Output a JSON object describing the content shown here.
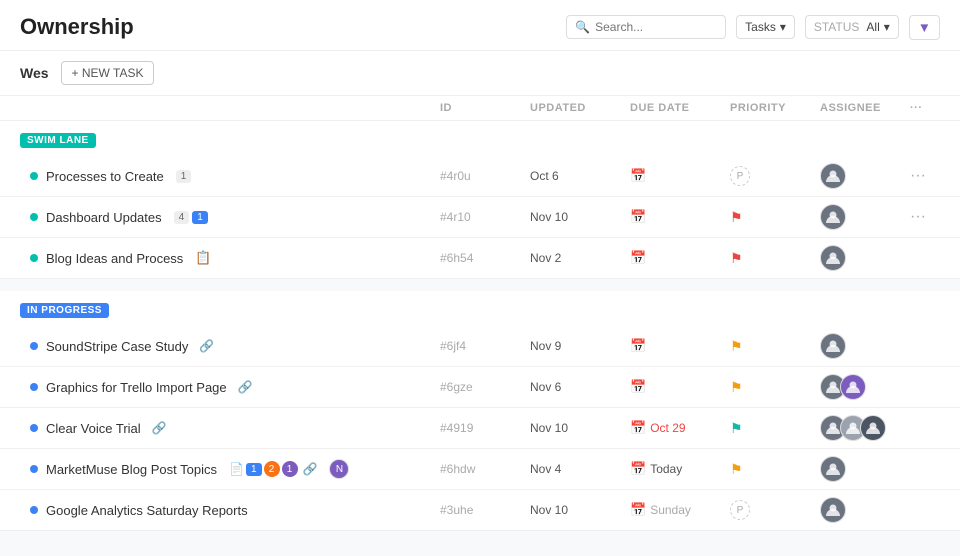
{
  "header": {
    "title": "Ownership",
    "search_placeholder": "Search...",
    "tasks_label": "Tasks",
    "status_label": "STATUS",
    "status_value": "All"
  },
  "subheader": {
    "user": "Wes",
    "new_task_label": "+ NEW TASK"
  },
  "table": {
    "columns": [
      "",
      "ID",
      "UPDATED",
      "DUE DATE",
      "PRIORITY",
      "ASSIGNEE",
      ""
    ],
    "swim_lane_badge": "SWIM LANE",
    "in_progress_badge": "IN PROGRESS"
  },
  "swim_lane_tasks": [
    {
      "name": "Processes to Create",
      "badge": "1",
      "id": "#4r0u",
      "updated": "Oct 6",
      "due": "",
      "priority": "none",
      "assignee": "dark"
    },
    {
      "name": "Dashboard Updates",
      "badge": "4",
      "badge2": "1",
      "id": "#4r10",
      "updated": "Nov 10",
      "due": "",
      "priority": "red",
      "assignee": "dark"
    },
    {
      "name": "Blog Ideas and Process",
      "emoji": "📋",
      "id": "#6h54",
      "updated": "Nov 2",
      "due": "",
      "priority": "red",
      "assignee": "dark"
    }
  ],
  "in_progress_tasks": [
    {
      "name": "SoundStripe Case Study",
      "link": true,
      "id": "#6jf4",
      "updated": "Nov 9",
      "due": "",
      "priority": "yellow",
      "assignee": [
        "dark"
      ]
    },
    {
      "name": "Graphics for Trello Import Page",
      "link": true,
      "id": "#6gze",
      "updated": "Nov 6",
      "due": "",
      "priority": "yellow",
      "assignee": [
        "dark",
        "purple"
      ]
    },
    {
      "name": "Clear Voice Trial",
      "link": true,
      "id": "#4919",
      "updated": "Nov 10",
      "due": "Oct 29",
      "due_overdue": true,
      "priority": "teal",
      "assignee": [
        "dark",
        "dark2",
        "dark3"
      ]
    },
    {
      "name": "MarketMuse Blog Post Topics",
      "badges": [
        "📄",
        "1",
        "2",
        "1"
      ],
      "link": true,
      "notify": true,
      "id": "#6hdw",
      "updated": "Nov 4",
      "due": "Today",
      "due_today": true,
      "priority": "yellow",
      "assignee": [
        "dark"
      ]
    },
    {
      "name": "Google Analytics Saturday Reports",
      "id": "#3uhe",
      "updated": "Nov 10",
      "due": "Sunday",
      "priority": "none",
      "assignee": [
        "dark"
      ]
    }
  ]
}
